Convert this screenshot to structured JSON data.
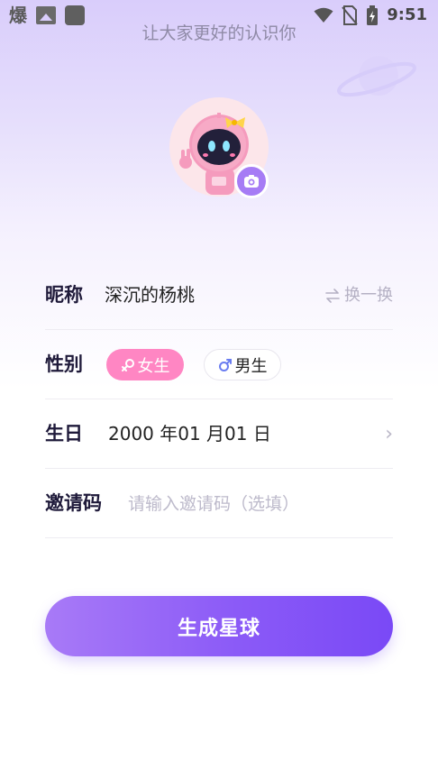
{
  "status_bar": {
    "app_glyph": "爆",
    "time": "9:51",
    "icons": [
      "image-icon",
      "app-square-icon",
      "wifi-icon",
      "no-sim-icon",
      "battery-icon"
    ]
  },
  "header": {
    "subtitle": "让大家更好的认识你"
  },
  "form": {
    "nickname": {
      "label": "昵称",
      "value": "深沉的杨桃",
      "swap_label": "换一换"
    },
    "gender": {
      "label": "性别",
      "female_label": "女生",
      "male_label": "男生",
      "selected": "female"
    },
    "birthday": {
      "label": "生日",
      "value": "2000 年01 月01 日"
    },
    "invite": {
      "label": "邀请码",
      "placeholder": "请输入邀请码（选填）",
      "value": ""
    }
  },
  "submit": {
    "label": "生成星球"
  },
  "colors": {
    "accent": "#8b5af7",
    "female_chip": "#ff86c3",
    "label_text": "#1f1a3a",
    "muted_text": "#b5b1c4"
  }
}
